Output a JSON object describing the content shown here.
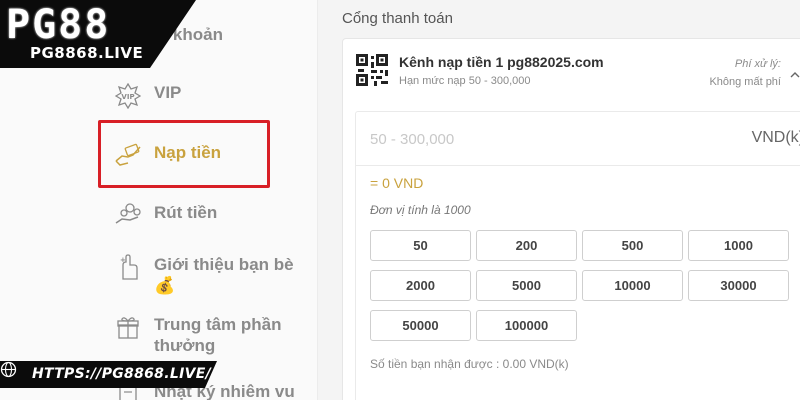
{
  "logo": {
    "brand": "PG88",
    "site": "PG8868.LIVE"
  },
  "watermark_url": "HTTPS://PG8868.LIVE/",
  "sidebar": {
    "items": [
      {
        "label": "ài khoản",
        "icon": "user-icon",
        "active": false
      },
      {
        "label": "VIP",
        "icon": "vip-badge-icon",
        "active": false
      },
      {
        "label": "Nạp tiền",
        "icon": "deposit-hand-icon",
        "active": true
      },
      {
        "label": "Rút tiền",
        "icon": "withdraw-coins-icon",
        "active": false
      },
      {
        "label": "Giới thiệu bạn bè 💰",
        "icon": "refer-friend-icon",
        "active": false
      },
      {
        "label": "Trung tâm phần thưởng",
        "icon": "gift-icon",
        "active": false
      },
      {
        "label": "Nhật ký nhiêm vu",
        "icon": "task-log-icon",
        "active": false
      }
    ]
  },
  "main": {
    "section_title": "Cổng thanh toán",
    "channel": {
      "title": "Kênh nạp tiền 1 pg882025.com",
      "limit": "Hạn mức nạp 50 - 300,000",
      "fee_label": "Phí xử lý:",
      "fee_value": "Không mất phí"
    },
    "amount": {
      "placeholder": "50 - 300,000",
      "currency": "VND(k)",
      "equals": "= 0 VND",
      "unit_note": "Đơn vị tính là 1000",
      "presets": [
        "50",
        "200",
        "500",
        "1000",
        "2000",
        "5000",
        "10000",
        "30000",
        "50000",
        "100000"
      ],
      "receive_text": "Số tiền bạn nhận được : 0.00 VND(k)"
    }
  },
  "colors": {
    "accent_gold": "#c9a23e",
    "highlight_red": "#d81f26",
    "text_gray": "#8a8a8a"
  }
}
